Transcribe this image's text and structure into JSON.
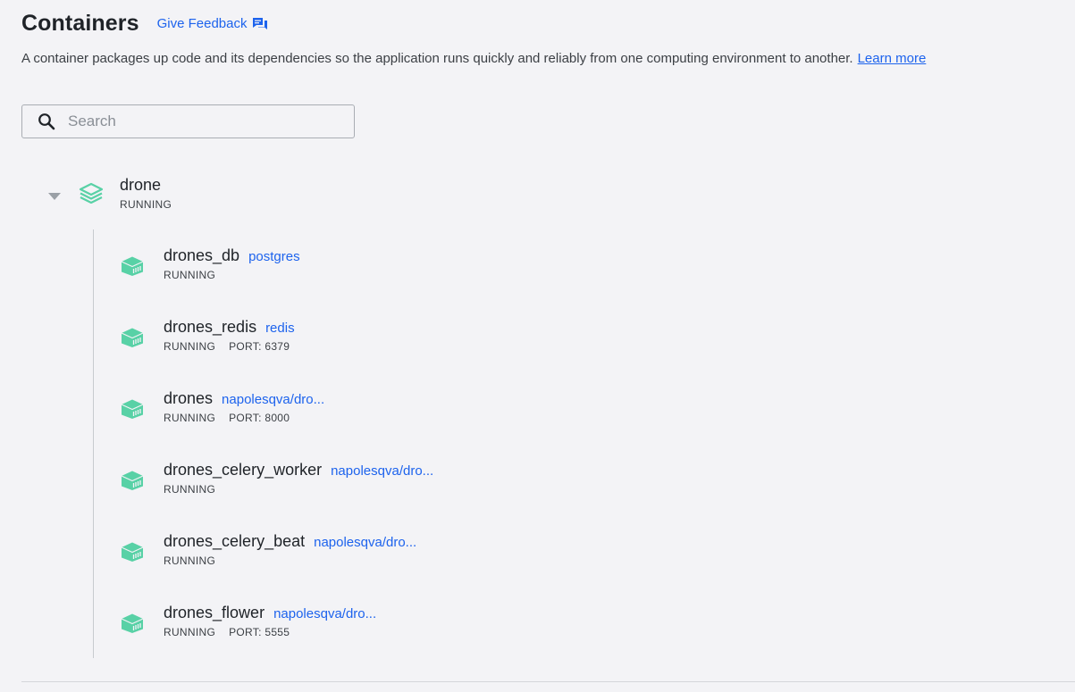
{
  "header": {
    "title": "Containers",
    "feedback_label": "Give Feedback",
    "feedback_icon": "feedback-icon"
  },
  "description": {
    "text": "A container packages up code and its dependencies so the application runs quickly and reliably from one computing environment to another.",
    "link": "Learn more"
  },
  "search": {
    "placeholder": "Search",
    "value": ""
  },
  "app": {
    "name": "drone",
    "status": "RUNNING",
    "icon": "stack-icon",
    "expanded": true
  },
  "containers": [
    {
      "name": "drones_db",
      "image": "postgres",
      "status": "RUNNING",
      "port": ""
    },
    {
      "name": "drones_redis",
      "image": "redis",
      "status": "RUNNING",
      "port": "PORT: 6379"
    },
    {
      "name": "drones",
      "image": "napolesqva/dro...",
      "status": "RUNNING",
      "port": "PORT: 8000"
    },
    {
      "name": "drones_celery_worker",
      "image": "napolesqva/dro...",
      "status": "RUNNING",
      "port": ""
    },
    {
      "name": "drones_celery_beat",
      "image": "napolesqva/dro...",
      "status": "RUNNING",
      "port": ""
    },
    {
      "name": "drones_flower",
      "image": "napolesqva/dro...",
      "status": "RUNNING",
      "port": "PORT: 5555"
    }
  ],
  "colors": {
    "accent": "#1d63ed",
    "running": "#58d1a6",
    "background": "#f3f3f6"
  }
}
